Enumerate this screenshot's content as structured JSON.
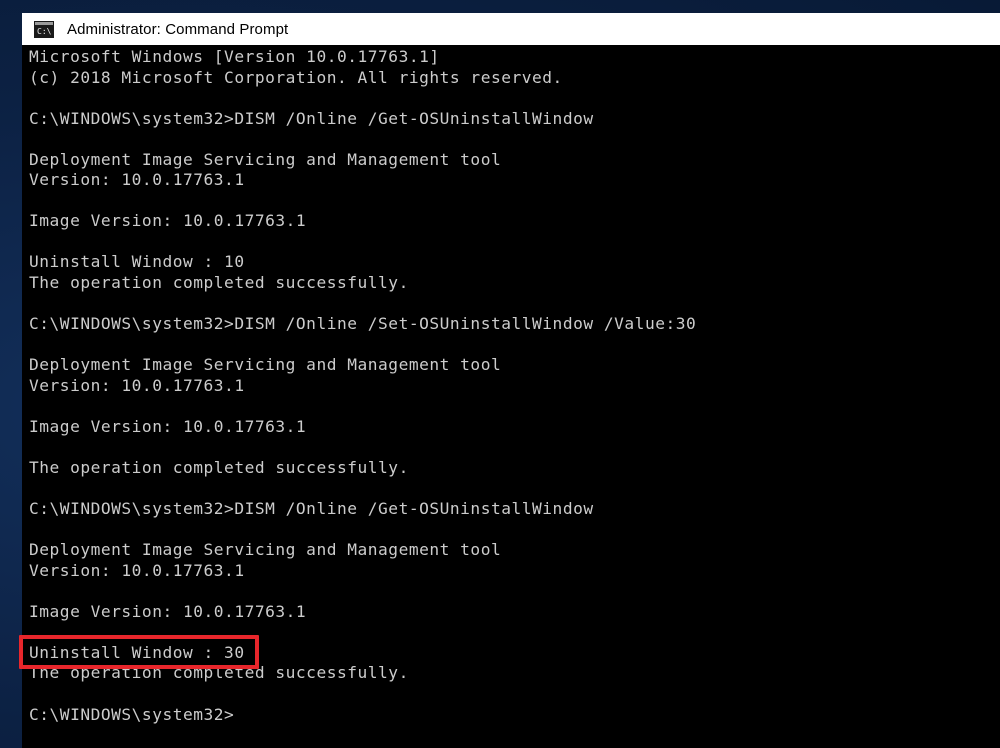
{
  "window": {
    "title": "Administrator: Command Prompt",
    "icon": "command-prompt-icon",
    "icon_label": "C:\\"
  },
  "colors": {
    "desktop_background": "#0c2143",
    "title_bar_background": "#ffffff",
    "title_bar_text": "#000000",
    "terminal_background": "#000000",
    "terminal_text": "#cccccc",
    "highlight_border": "#e8262b"
  },
  "terminal": {
    "lines": [
      "Microsoft Windows [Version 10.0.17763.1]",
      "(c) 2018 Microsoft Corporation. All rights reserved.",
      "",
      "C:\\WINDOWS\\system32>DISM /Online /Get-OSUninstallWindow",
      "",
      "Deployment Image Servicing and Management tool",
      "Version: 10.0.17763.1",
      "",
      "Image Version: 10.0.17763.1",
      "",
      "Uninstall Window : 10",
      "The operation completed successfully.",
      "",
      "C:\\WINDOWS\\system32>DISM /Online /Set-OSUninstallWindow /Value:30",
      "",
      "Deployment Image Servicing and Management tool",
      "Version: 10.0.17763.1",
      "",
      "Image Version: 10.0.17763.1",
      "",
      "The operation completed successfully.",
      "",
      "C:\\WINDOWS\\system32>DISM /Online /Get-OSUninstallWindow",
      "",
      "Deployment Image Servicing and Management tool",
      "Version: 10.0.17763.1",
      "",
      "Image Version: 10.0.17763.1",
      "",
      "Uninstall Window : 30",
      "The operation completed successfully.",
      "",
      "C:\\WINDOWS\\system32>"
    ]
  },
  "annotation": {
    "highlighted_text": "Uninstall Window : 30"
  }
}
